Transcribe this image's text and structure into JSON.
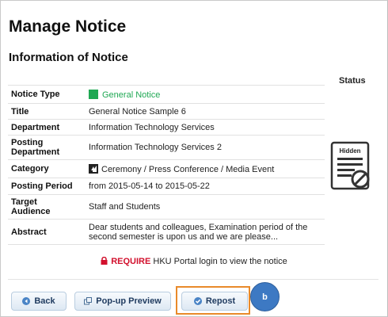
{
  "page": {
    "title": "Manage Notice",
    "section_title": "Information of Notice",
    "status_header": "Status"
  },
  "notice": {
    "rows": [
      {
        "label": "Notice Type",
        "value": "General Notice"
      },
      {
        "label": "Title",
        "value": "General Notice Sample 6"
      },
      {
        "label": "Department",
        "value": "Information Technology Services"
      },
      {
        "label": "Posting Department",
        "value": "Information Technology Services 2"
      },
      {
        "label": "Category",
        "value": "Ceremony / Press Conference / Media Event"
      },
      {
        "label": "Posting Period",
        "value": "from 2015-05-14 to 2015-05-22"
      },
      {
        "label": "Target Audience",
        "value": "Staff and Students"
      },
      {
        "label": "Abstract",
        "value": "Dear students and colleagues, Examination period of the second semester is upon us and we are please..."
      }
    ],
    "type_color": "#1fa853",
    "category_icon": "press-conference-icon"
  },
  "status": {
    "label": "Hidden",
    "icon": "hidden-document-icon"
  },
  "login_notice": {
    "require": "REQUIRE",
    "text": "HKU Portal login to view the notice",
    "icon": "lock-icon"
  },
  "buttons": {
    "back": "Back",
    "popup": "Pop-up Preview",
    "repost": "Repost"
  },
  "annotation": {
    "badge": "b",
    "highlight_color": "#e98a2a"
  }
}
